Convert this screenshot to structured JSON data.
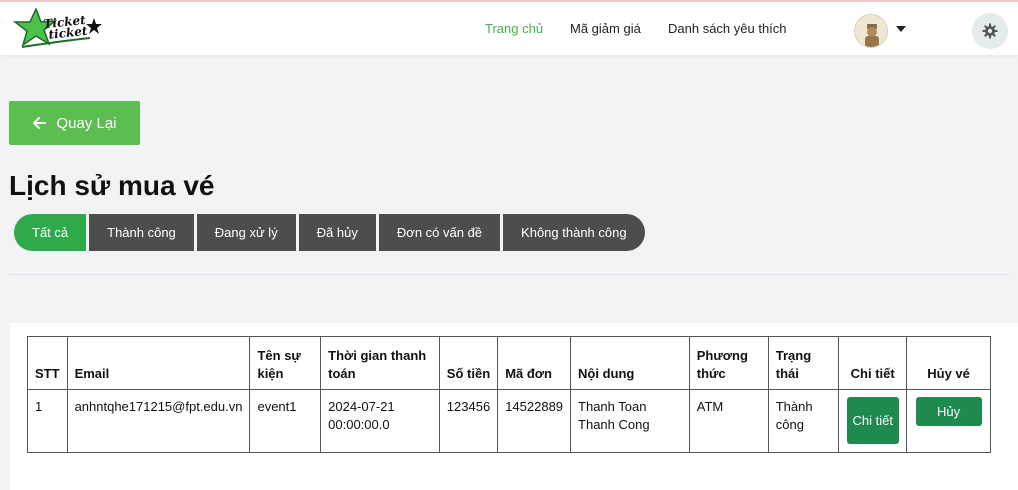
{
  "header": {
    "logo_text_line1": "Ticket",
    "logo_text_line2": "ticket",
    "nav": [
      {
        "label": "Trang chủ",
        "active": true
      },
      {
        "label": "Mã giảm giá",
        "active": false
      },
      {
        "label": "Danh sách yêu thích",
        "active": false
      }
    ]
  },
  "back_label": "Quay Lại",
  "page_title": "Lịch sử mua vé",
  "tabs": [
    "Tất cả",
    "Thành công",
    "Đang xử lý",
    "Đã hủy",
    "Đơn có vấn đề",
    "Không thành công"
  ],
  "table": {
    "headers": [
      "STT",
      "Email",
      "Tên sự kiện",
      "Thời gian thanh toán",
      "Số tiền",
      "Mã đơn",
      "Nội dung",
      "Phương thức",
      "Trạng thái",
      "Chi tiết",
      "Hủy vé"
    ],
    "rows": [
      {
        "stt": "1",
        "email": "anhntqhe171215@fpt.edu.vn",
        "event": "event1",
        "time": "2024-07-21 00:00:00.0",
        "amount": "123456",
        "order_code": "14522889",
        "content": "Thanh Toan Thanh Cong",
        "method": "ATM",
        "status": "Thành công",
        "detail_label": "Chi tiết",
        "cancel_label": "Hủy"
      }
    ]
  },
  "colors": {
    "brand_green": "#5cbd50",
    "active_tab": "#2eaa4a",
    "inactive_tab": "#4d4d4d",
    "action_green": "#1e8a4e",
    "nav_active": "#3eb54a"
  }
}
